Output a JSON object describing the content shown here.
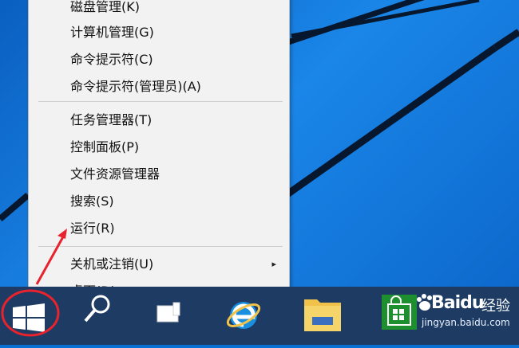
{
  "context_menu": {
    "items_group1": [
      {
        "label": "磁盘管理(K)"
      },
      {
        "label": "计算机管理(G)"
      },
      {
        "label": "命令提示符(C)"
      },
      {
        "label": "命令提示符(管理员)(A)"
      }
    ],
    "items_group2": [
      {
        "label": "任务管理器(T)"
      },
      {
        "label": "控制面板(P)"
      },
      {
        "label": "文件资源管理器"
      },
      {
        "label": "搜索(S)"
      },
      {
        "label": "运行(R)"
      }
    ],
    "items_group3": [
      {
        "label": "关机或注销(U)",
        "has_submenu": true
      },
      {
        "label": "桌面(D)"
      }
    ],
    "submenu_arrow": "▸"
  },
  "taskbar": {
    "icons": [
      "start-button-windows-logo",
      "search-icon",
      "task-view-icon",
      "edge-icon",
      "file-explorer-icon",
      "store-icon"
    ]
  },
  "watermark": {
    "brand": "Baidu",
    "jingyan": "经验",
    "domain": "jingyan.baidu.com"
  },
  "colors": {
    "desktop": "#0a6fd0",
    "taskbar": "#1d3b63",
    "menu_bg": "#f2f2f2",
    "annotation_red": "#e8232d",
    "store_green": "#1e8f2e",
    "folder_yellow": "#f0c24a",
    "edge_blue": "#1a8fe0"
  }
}
